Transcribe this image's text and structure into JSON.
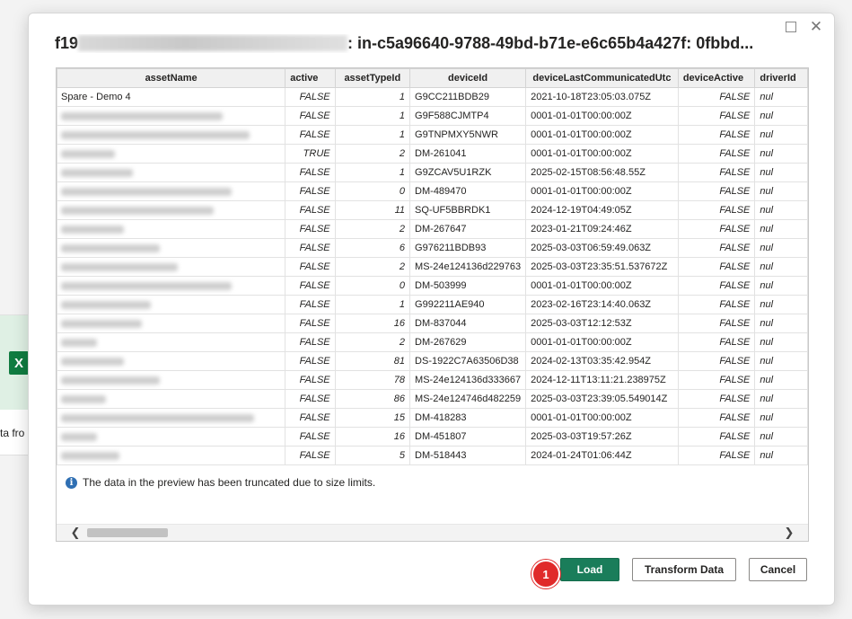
{
  "background": {
    "partial_text": "ta fro"
  },
  "dialog": {
    "title_prefix": "f19",
    "title_suffix": ": in-c5a96640-9788-49bd-b71e-e6c65b4a427f: 0fbbd...",
    "info_text": "The data in the preview has been truncated due to size limits.",
    "buttons": {
      "load": "Load",
      "transform": "Transform Data",
      "cancel": "Cancel"
    },
    "step_badge": "1"
  },
  "table": {
    "headers": [
      "assetName",
      "active",
      "assetTypeId",
      "deviceId",
      "deviceLastCommunicatedUtc",
      "deviceActive",
      "driverId"
    ],
    "rows": [
      {
        "name": "Spare - Demo 4",
        "active": "FALSE",
        "type": "1",
        "device": "G9CC211BDB29",
        "last": "2021-10-18T23:05:03.075Z",
        "devActive": "FALSE",
        "driver": "nul"
      },
      {
        "name": "",
        "active": "FALSE",
        "type": "1",
        "device": "G9F588CJMTP4",
        "last": "0001-01-01T00:00:00Z",
        "devActive": "FALSE",
        "driver": "nul"
      },
      {
        "name": "",
        "active": "FALSE",
        "type": "1",
        "device": "G9TNPMXY5NWR",
        "last": "0001-01-01T00:00:00Z",
        "devActive": "FALSE",
        "driver": "nul"
      },
      {
        "name": "",
        "active": "TRUE",
        "type": "2",
        "device": "DM-261041",
        "last": "0001-01-01T00:00:00Z",
        "devActive": "FALSE",
        "driver": "nul"
      },
      {
        "name": "",
        "active": "FALSE",
        "type": "1",
        "device": "G9ZCAV5U1RZK",
        "last": "2025-02-15T08:56:48.55Z",
        "devActive": "FALSE",
        "driver": "nul"
      },
      {
        "name": "",
        "active": "FALSE",
        "type": "0",
        "device": "DM-489470",
        "last": "0001-01-01T00:00:00Z",
        "devActive": "FALSE",
        "driver": "nul"
      },
      {
        "name": "",
        "active": "FALSE",
        "type": "11",
        "device": "SQ-UF5BBRDK1",
        "last": "2024-12-19T04:49:05Z",
        "devActive": "FALSE",
        "driver": "nul"
      },
      {
        "name": "",
        "active": "FALSE",
        "type": "2",
        "device": "DM-267647",
        "last": "2023-01-21T09:24:46Z",
        "devActive": "FALSE",
        "driver": "nul"
      },
      {
        "name": "",
        "active": "FALSE",
        "type": "6",
        "device": "G976211BDB93",
        "last": "2025-03-03T06:59:49.063Z",
        "devActive": "FALSE",
        "driver": "nul"
      },
      {
        "name": "",
        "active": "FALSE",
        "type": "2",
        "device": "MS-24e124136d229763",
        "last": "2025-03-03T23:35:51.537672Z",
        "devActive": "FALSE",
        "driver": "nul"
      },
      {
        "name": "",
        "active": "FALSE",
        "type": "0",
        "device": "DM-503999",
        "last": "0001-01-01T00:00:00Z",
        "devActive": "FALSE",
        "driver": "nul"
      },
      {
        "name": "",
        "active": "FALSE",
        "type": "1",
        "device": "G992211AE940",
        "last": "2023-02-16T23:14:40.063Z",
        "devActive": "FALSE",
        "driver": "nul"
      },
      {
        "name": "",
        "active": "FALSE",
        "type": "16",
        "device": "DM-837044",
        "last": "2025-03-03T12:12:53Z",
        "devActive": "FALSE",
        "driver": "nul"
      },
      {
        "name": "",
        "active": "FALSE",
        "type": "2",
        "device": "DM-267629",
        "last": "0001-01-01T00:00:00Z",
        "devActive": "FALSE",
        "driver": "nul"
      },
      {
        "name": "",
        "active": "FALSE",
        "type": "81",
        "device": "DS-1922C7A63506D38",
        "last": "2024-02-13T03:35:42.954Z",
        "devActive": "FALSE",
        "driver": "nul"
      },
      {
        "name": "",
        "active": "FALSE",
        "type": "78",
        "device": "MS-24e124136d333667",
        "last": "2024-12-11T13:11:21.238975Z",
        "devActive": "FALSE",
        "driver": "nul"
      },
      {
        "name": "",
        "active": "FALSE",
        "type": "86",
        "device": "MS-24e124746d482259",
        "last": "2025-03-03T23:39:05.549014Z",
        "devActive": "FALSE",
        "driver": "nul"
      },
      {
        "name": "",
        "active": "FALSE",
        "type": "15",
        "device": "DM-418283",
        "last": "0001-01-01T00:00:00Z",
        "devActive": "FALSE",
        "driver": "nul"
      },
      {
        "name": "",
        "active": "FALSE",
        "type": "16",
        "device": "DM-451807",
        "last": "2025-03-03T19:57:26Z",
        "devActive": "FALSE",
        "driver": "nul"
      },
      {
        "name": "",
        "active": "FALSE",
        "type": "5",
        "device": "DM-518443",
        "last": "2024-01-24T01:06:44Z",
        "devActive": "FALSE",
        "driver": "nul"
      }
    ]
  },
  "colors": {
    "load_button": "#1a7d5a",
    "badge": "#e02a2a",
    "info_icon": "#2f6fb3"
  },
  "icons": {
    "info": "info-icon",
    "close": "close-icon",
    "maximize": "maximize-icon",
    "scroll_left": "chevron-left-icon",
    "scroll_right": "chevron-right-icon",
    "excel": "excel-icon"
  }
}
